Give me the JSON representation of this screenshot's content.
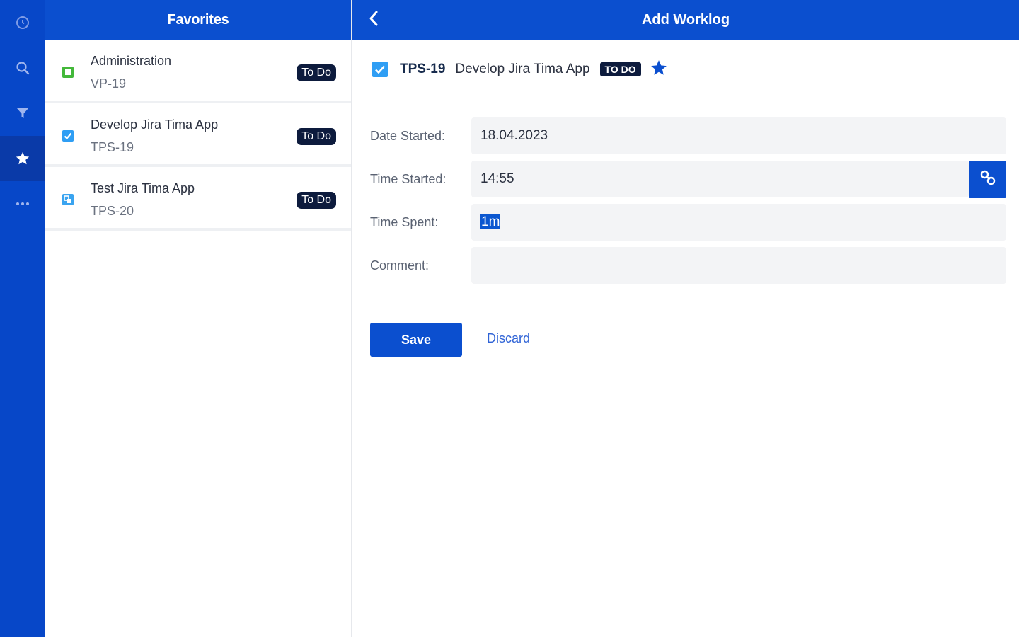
{
  "nav": {
    "items": [
      {
        "icon": "clock-icon"
      },
      {
        "icon": "search-icon"
      },
      {
        "icon": "filter-icon"
      },
      {
        "icon": "star-icon",
        "active": true
      },
      {
        "icon": "more-icon"
      }
    ]
  },
  "favorites": {
    "title": "Favorites",
    "items": [
      {
        "name": "Administration",
        "key": "VP-19",
        "status": "To Do",
        "icon": "story-icon",
        "icon_color": "#43b83a"
      },
      {
        "name": "Develop Jira Tima App",
        "key": "TPS-19",
        "status": "To Do",
        "icon": "task-icon",
        "icon_color": "#2f9ef4"
      },
      {
        "name": "Test Jira Tima App",
        "key": "TPS-20",
        "status": "To Do",
        "icon": "subtask-icon",
        "icon_color": "#3aa4f0"
      }
    ]
  },
  "detail": {
    "title": "Add Worklog",
    "issue": {
      "key": "TPS-19",
      "summary": "Develop Jira Tima App",
      "status": "TO DO"
    },
    "form": {
      "date_label": "Date Started:",
      "date_value": "18.04.2023",
      "time_label": "Time Started:",
      "time_value": "14:55",
      "spent_label": "Time Spent:",
      "spent_value": "1m",
      "comment_label": "Comment:",
      "comment_value": ""
    },
    "save_label": "Save",
    "discard_label": "Discard"
  },
  "colors": {
    "primary": "#0b4fcf",
    "rail": "#0747c8",
    "badge": "#0d1b3d",
    "link": "#2f63d6"
  }
}
